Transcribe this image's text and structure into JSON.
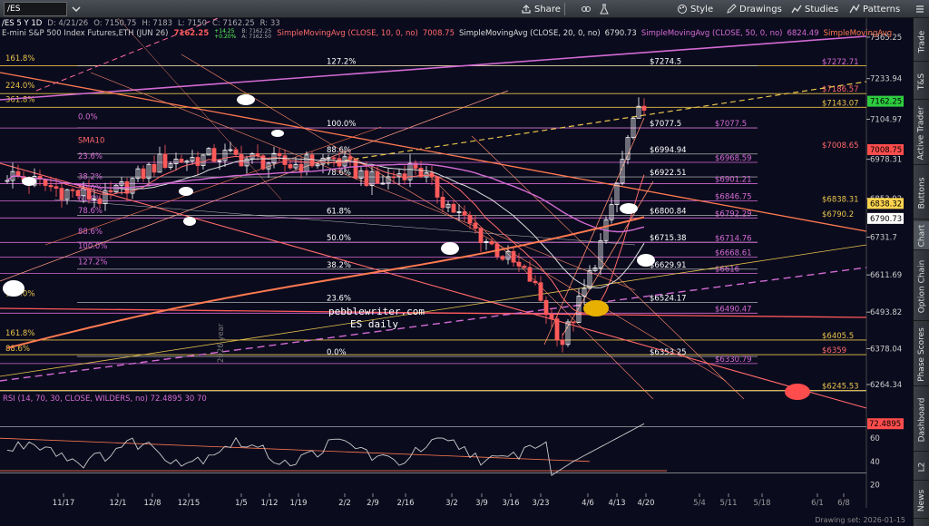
{
  "toolbar": {
    "symbol": "/ES",
    "share": "Share",
    "style": "Style",
    "drawings": "Drawings",
    "studies": "Studies",
    "patterns": "Patterns"
  },
  "info": {
    "symbol": "/ES 5 Y 1D",
    "date": "D: 4/21/26",
    "open": "O: 7150.75",
    "high": "H: 7183",
    "low": "L: 7150",
    "close": "C: 7162.25",
    "range": "R: 33",
    "description": "E-mini S&P 500 Index Futures,ETH (JUN 26)",
    "last": "7162.25",
    "change": "+14.25",
    "change_pct": "+0.20%",
    "bid": "B: 7162.25",
    "ask": "A: 7162.50"
  },
  "studies": [
    {
      "text": "SimpleMovingAvg (CLOSE, 10, 0, no)",
      "color": "#ff6a6a"
    },
    {
      "text": "7008.75",
      "color": "#ff6a6a"
    },
    {
      "text": "SimpleMovingAvg (CLOSE, 20, 0, no)",
      "color": "#dddddd"
    },
    {
      "text": "6790.73",
      "color": "#dddddd"
    },
    {
      "text": "SimpleMovingAvg (CLOSE, 50, 0, no)",
      "color": "#d36bd3"
    },
    {
      "text": "6824.49",
      "color": "#d36bd3"
    },
    {
      "text": "SimpleMovingAvg",
      "color": "#ff7a50"
    }
  ],
  "rsi": {
    "label": "RSI (14, 70, 30, CLOSE, WILDERS, no)",
    "value": "72.4895",
    "ob": "30",
    "os": "70",
    "ticks": [
      "60",
      "40",
      "20"
    ],
    "current": "72.4895"
  },
  "price_axis": [
    "7365.25",
    "7233.94",
    "7104.97",
    "6978.31",
    "6853.92",
    "6731.7",
    "6611.69",
    "6493.82",
    "6378.04",
    "6264.34"
  ],
  "price_badges": [
    {
      "text": "7162.25",
      "bg": "#2ecc40",
      "fg": "#000000"
    },
    {
      "text": "7008.75",
      "bg": "#ff4d4d",
      "fg": "#000000"
    },
    {
      "text": "6838.32",
      "bg": "#ffd54f",
      "fg": "#000000"
    },
    {
      "text": "6790.73",
      "bg": "#ffffff",
      "fg": "#000000"
    }
  ],
  "date_axis": [
    "11/17",
    "12/1",
    "12/8",
    "12/15",
    "1/5",
    "1/12",
    "1/19",
    "2/2",
    "2/9",
    "2/16",
    "3/2",
    "3/9",
    "3/16",
    "3/23",
    "4/6",
    "4/13",
    "4/20",
    "5/4",
    "5/11",
    "5/18",
    "6/1",
    "6/8"
  ],
  "fib_left": [
    "161.8%",
    "224.0%",
    "361.8%",
    "0.0%",
    "SMA10",
    "23.6%",
    "38.2%",
    "50.0%",
    "61.8%",
    "78.6%",
    "88.6%",
    "100.0%",
    "127.2%",
    "100.0%",
    "161.8%",
    "88.6%"
  ],
  "fib_mid": [
    "127.2%",
    "100.0%",
    "88.6%",
    "78.6%",
    "61.8%",
    "50.0%",
    "38.2%",
    "23.6%",
    "0.0%"
  ],
  "fib_mid_vals": [
    "$7274.5",
    "$7077.5",
    "$6994.94",
    "$6922.51",
    "$6800.84",
    "$6715.38",
    "$6629.91",
    "$6524.17",
    "$6353.25"
  ],
  "fib_pink_vals": [
    "$7077.5",
    "$6968.59",
    "$6901.21",
    "$6846.75",
    "$6792.29",
    "$6714.76",
    "$6668.61",
    "$6616",
    "$6490.47",
    "$6330.79"
  ],
  "fib_right_vals": [
    "$7272.71",
    "$7186.57",
    "$7143.07",
    "$7008.65",
    "$6838.31",
    "$6790.2",
    "$6405.5",
    "$6359",
    "$6245.53"
  ],
  "watermark": {
    "line1": "pebblewriter.com",
    "line2": "ES daily"
  },
  "year_label": "2026 year",
  "rightbar_tabs": [
    "Trade",
    "T&S",
    "Active Trader",
    "Buttons",
    "Chart",
    "Option Chain",
    "Phase Scores",
    "Dashboard",
    "L2",
    "News"
  ],
  "drawing_set": "Drawing set: 2026-01-15",
  "colors": {
    "bg": "#0b0b1e",
    "sma10": "#ff6a6a",
    "sma20": "#dddddd",
    "sma50": "#d36bd3",
    "sma200": "#ff7a50",
    "fib_gold": "#e8c44a",
    "fib_pink": "#d36bd3",
    "up": "#ffffff",
    "down": "#ff5a5a"
  }
}
